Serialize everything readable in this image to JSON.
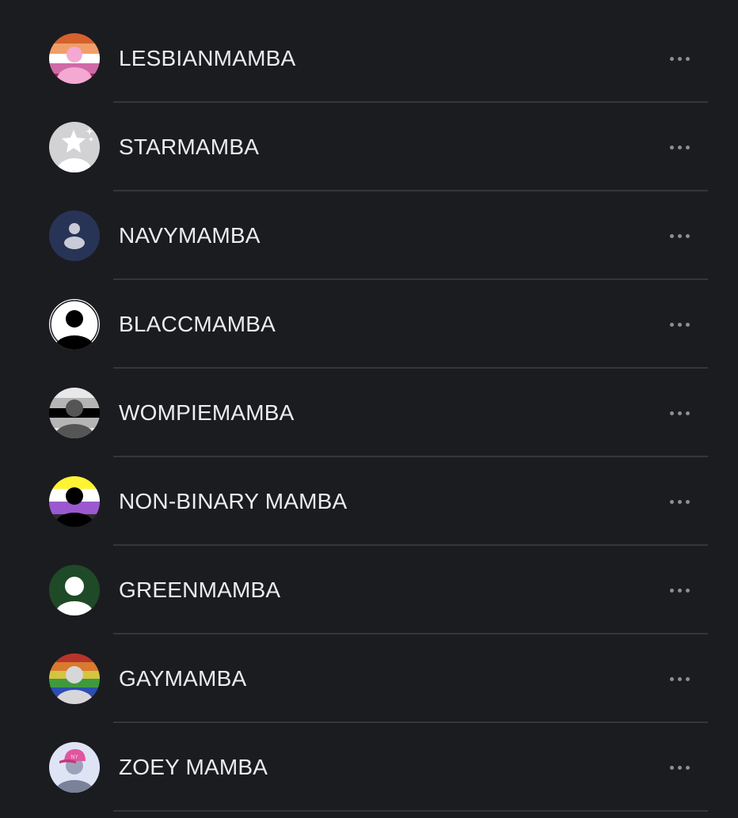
{
  "contacts": [
    {
      "name": "LESBIANMAMBA",
      "avatar": "lesbian-flag-avatar"
    },
    {
      "name": "STARMAMBA",
      "avatar": "star-avatar"
    },
    {
      "name": "NAVYMAMBA",
      "avatar": "navy-person-avatar"
    },
    {
      "name": "BLACCMAMBA",
      "avatar": "black-person-avatar"
    },
    {
      "name": "WOMPIEMAMBA",
      "avatar": "greyscale-flag-avatar"
    },
    {
      "name": "NON-BINARY MAMBA",
      "avatar": "nonbinary-flag-avatar"
    },
    {
      "name": "GREENMAMBA",
      "avatar": "green-person-avatar"
    },
    {
      "name": "GAYMAMBA",
      "avatar": "rainbow-flag-avatar"
    },
    {
      "name": "ZOEY MAMBA",
      "avatar": "pink-cap-avatar"
    }
  ],
  "more_icon": "more-horizontal-icon",
  "colors": {
    "background": "#1b1c20",
    "text": "#ececef",
    "divider": "#35363b",
    "more_dots": "#8d8e93"
  }
}
